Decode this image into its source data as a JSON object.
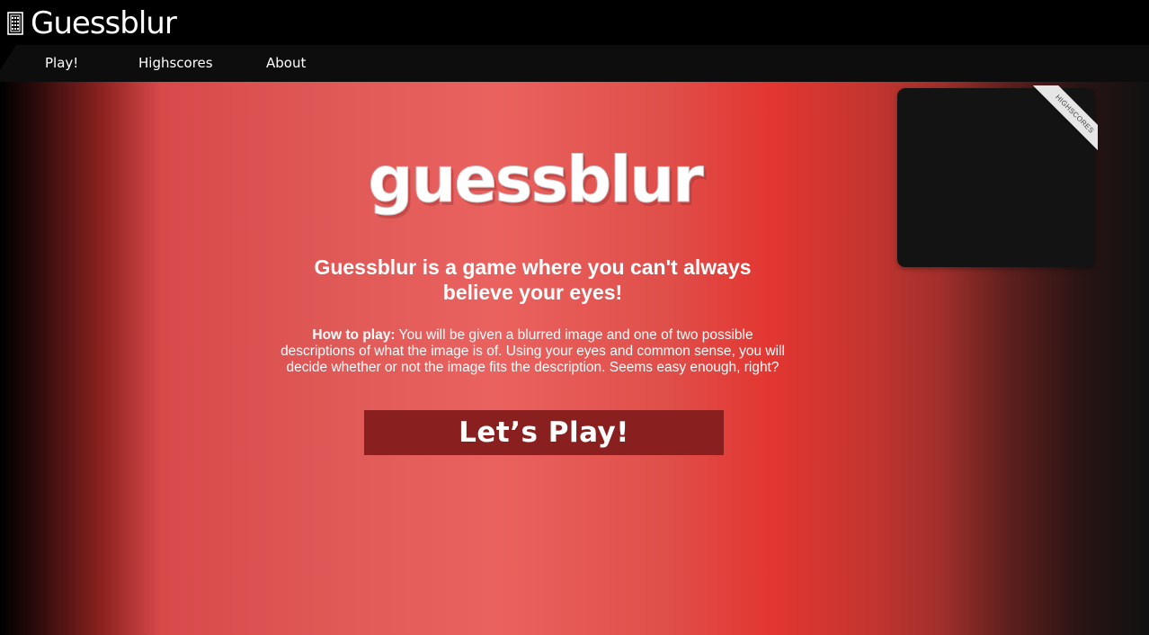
{
  "header": {
    "title": "Guessblur",
    "icon": "building-icon"
  },
  "nav": {
    "items": [
      {
        "label": "Play!"
      },
      {
        "label": "Highscores"
      },
      {
        "label": "About"
      }
    ]
  },
  "main": {
    "game_title": "guessblur",
    "tagline": "Guessblur is a game where you can't always believe your eyes!",
    "howto_label": "How to play:",
    "howto_text": " You will be given a blurred image and one of two possible descriptions of what the image is of. Using your eyes and common sense, you will decide whether or not the image fits the description. Seems easy enough, right?",
    "play_button_label": "Let’s Play!"
  },
  "highscores_panel": {
    "ribbon_label": "HIGHSCORES"
  },
  "colors": {
    "accent": "#e33631",
    "button_bg": "#8a1f1f",
    "topbar_bg": "#000000",
    "navbar_bg": "#0d0d0d",
    "panel_bg": "#131313"
  }
}
